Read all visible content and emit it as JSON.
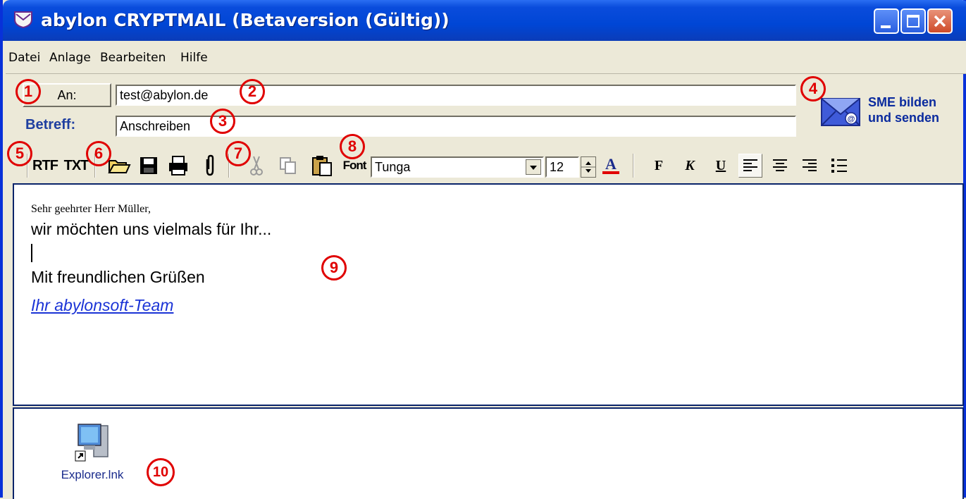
{
  "window": {
    "title": "abylon CRYPTMAIL (Betaversion (Gültig))",
    "controls": [
      "minimize",
      "maximize",
      "close"
    ]
  },
  "menu": [
    "Datei",
    "Anlage",
    "Bearbeiten",
    "Hilfe"
  ],
  "header": {
    "to_button_label": "An:",
    "to_value": "test@abylon.de",
    "subject_label": "Betreff:",
    "subject_value": "Anschreiben",
    "send_line1": "SME bilden",
    "send_line2": "und senden"
  },
  "toolbar": {
    "rtf_label": "RTF",
    "txt_label": "TXT",
    "font_label": "Font",
    "font_name": "Tunga",
    "font_size": "12",
    "bold_label": "F",
    "italic_label": "K",
    "underline_label": "U"
  },
  "editor": {
    "greeting": "Sehr geehrter Herr Müller,",
    "line1": "wir möchten uns vielmals für Ihr...",
    "closing": "Mit freundlichen Grüßen",
    "signature": "Ihr abylonsoft-Team"
  },
  "attachments": [
    {
      "name": "Explorer.lnk",
      "icon": "computer-shortcut-icon"
    }
  ],
  "callouts": [
    "1",
    "2",
    "3",
    "4",
    "5",
    "6",
    "7",
    "8",
    "9",
    "10"
  ],
  "colors": {
    "titlebar": "#0046d5",
    "window_border": "#0831d9",
    "callout": "#e00000",
    "label_blue": "#1f3fa0",
    "link_blue": "#1a33d6"
  }
}
